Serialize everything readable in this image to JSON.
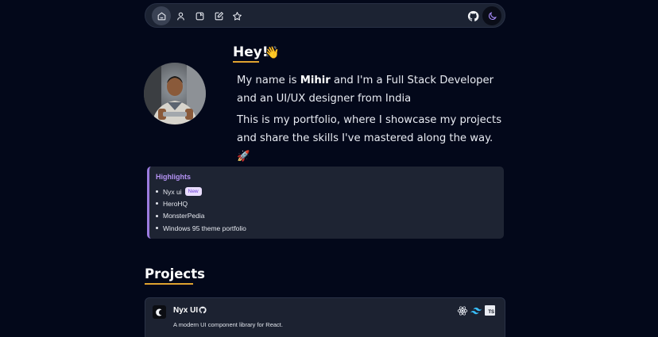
{
  "nav": {
    "items": [
      {
        "icon": "home-icon"
      },
      {
        "icon": "user-icon"
      },
      {
        "icon": "folder-icon"
      },
      {
        "icon": "edit-icon"
      },
      {
        "icon": "star-icon"
      }
    ],
    "github_icon": "github-icon",
    "theme_icon": "moon-icon"
  },
  "hero": {
    "greeting": "Hey!",
    "wave_emoji": "👋",
    "intro_prefix": "My name is ",
    "name": "Mihir",
    "intro_suffix": " and I'm a Full Stack Developer and an UI/UX designer from India",
    "portfolio_text": "This is my portfolio, where I showcase my projects and share the skills I've mastered along the way. 🚀"
  },
  "highlights": {
    "title": "Highlights",
    "items": [
      {
        "label": "Nyx ui",
        "badge": "New"
      },
      {
        "label": "HeroHQ"
      },
      {
        "label": "MonsterPedia"
      },
      {
        "label": "Windows 95 theme portfolio"
      }
    ]
  },
  "projects": {
    "title": "Projects",
    "cards": [
      {
        "name": "Nyx UI",
        "description": "A modern UI component library for React.",
        "tech": [
          "react-icon",
          "tailwind-icon",
          "typescript-icon"
        ],
        "tech_ts_label": "TS"
      }
    ]
  },
  "colors": {
    "background": "#03081a",
    "surface": "#1c2333",
    "accent_underline": "#e0a32f",
    "highlight_accent": "#9b7be0"
  }
}
